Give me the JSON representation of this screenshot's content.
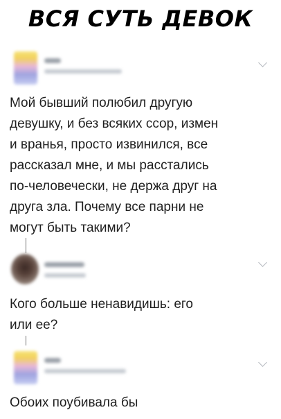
{
  "header": {
    "title": "ВСЯ СУТЬ ДЕВОК"
  },
  "posts": [
    {
      "text": "Мой бывший полюбил другую\nдевушку, и без всяких ссор, измен\nи вранья, просто извинился, все\nрассказал мне, и мы расстались\nпо-человечески, не держа друг на\nдруга зла. Почему все парни не\nмогут быть такими?"
    },
    {
      "text": "Кого больше ненавидишь: его\nили ее?"
    },
    {
      "text": "Обоих поубивала бы"
    }
  ],
  "icons": {
    "chevron": "chevron-down-icon"
  }
}
